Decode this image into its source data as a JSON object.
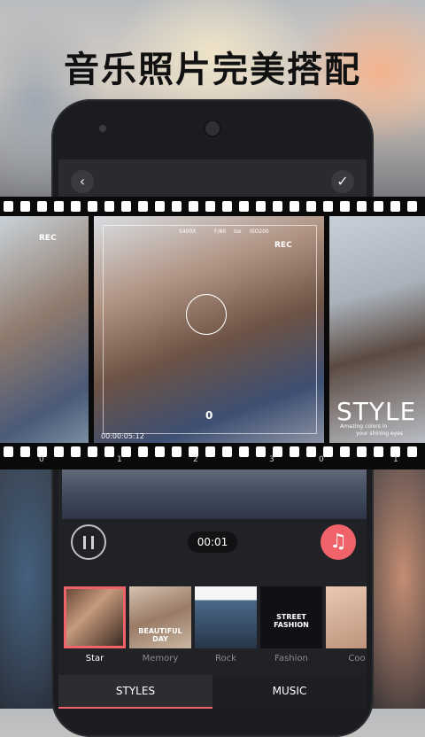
{
  "headline": "音乐照片完美搭配",
  "topbar": {
    "back_icon": "‹",
    "confirm_icon": "✓"
  },
  "film": {
    "rec_label": "REC",
    "hud_readout": [
      "S400X",
      "F/60",
      "Iso",
      "ISO200"
    ],
    "style_word": "STYLE",
    "style_sub_1": "Amazing colors in",
    "style_sub_2": "your shining eyes",
    "timecode": "00:00:05:12",
    "numbers": [
      "0",
      "1",
      "2",
      "3",
      "0",
      "1"
    ],
    "center_zero": "0"
  },
  "player": {
    "time": "00:01",
    "pause_icon": "pause",
    "music_icon": "♫"
  },
  "styles": [
    {
      "label": "Star",
      "selected": true
    },
    {
      "label": "Memory",
      "selected": false,
      "thumb_text": "BEAUTIFUL DAY"
    },
    {
      "label": "Rock",
      "selected": false
    },
    {
      "label": "Fashion",
      "selected": false,
      "thumb_text": "STREET FASHION"
    },
    {
      "label": "Coo",
      "selected": false
    }
  ],
  "tabs": {
    "styles": "STYLES",
    "music": "MUSIC"
  },
  "colors": {
    "accent": "#f0636a",
    "screen_bg": "#212225"
  }
}
